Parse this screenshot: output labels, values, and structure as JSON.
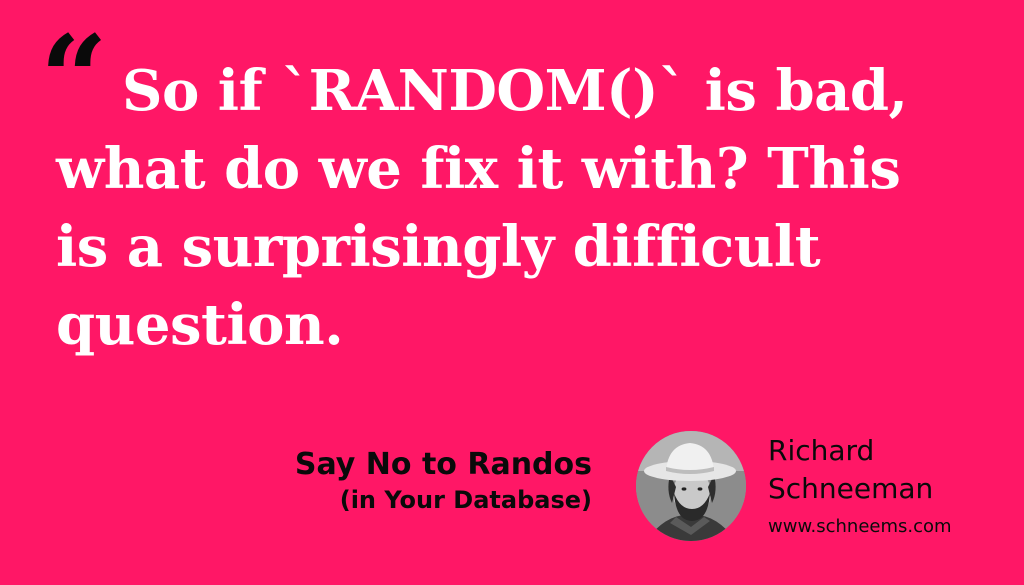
{
  "quote": {
    "mark": "“",
    "lines": [
      "So if `RANDOM()` is bad,",
      "what do we fix it with? This",
      "is a surprisingly difficult",
      "question."
    ]
  },
  "book": {
    "title": "Say No to Randos",
    "subtitle": "(in Your Database)"
  },
  "author": {
    "first_name": "Richard",
    "last_name": "Schneeman",
    "website": "www.schneems.com"
  },
  "colors": {
    "background": "#ff1766",
    "quote_text": "#ffffff",
    "accent_text": "#0a0a0a"
  }
}
